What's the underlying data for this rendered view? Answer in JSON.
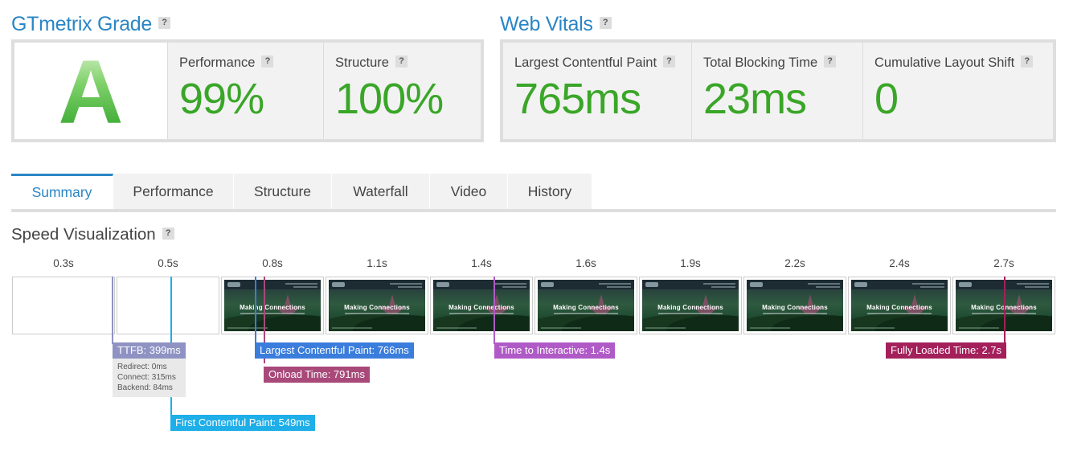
{
  "gtmetrix_grade": {
    "title": "GTmetrix Grade",
    "grade": "A",
    "performance": {
      "label": "Performance",
      "value": "99%"
    },
    "structure": {
      "label": "Structure",
      "value": "100%"
    }
  },
  "web_vitals": {
    "title": "Web Vitals",
    "lcp": {
      "label": "Largest Contentful Paint",
      "value": "765ms"
    },
    "tbt": {
      "label": "Total Blocking Time",
      "value": "23ms"
    },
    "cls": {
      "label": "Cumulative Layout Shift",
      "value": "0"
    }
  },
  "help_icon": "?",
  "tabs": [
    "Summary",
    "Performance",
    "Structure",
    "Waterfall",
    "Video",
    "History"
  ],
  "active_tab": "Summary",
  "speed_visualization": {
    "title": "Speed Visualization",
    "frame_times": [
      "0.3s",
      "0.5s",
      "0.8s",
      "1.1s",
      "1.4s",
      "1.6s",
      "1.9s",
      "2.2s",
      "2.4s",
      "2.7s"
    ],
    "frame_hero_text": "Making Connections",
    "markers": {
      "ttfb": "TTFB: 399ms",
      "ttfb_redirect": "Redirect: 0ms",
      "ttfb_connect": "Connect: 315ms",
      "ttfb_backend": "Backend: 84ms",
      "fcp": "First Contentful Paint: 549ms",
      "lcp": "Largest Contentful Paint: 766ms",
      "onload": "Onload Time: 791ms",
      "tti": "Time to Interactive: 1.4s",
      "fully_loaded": "Fully Loaded Time: 2.7s"
    },
    "marker_colors": {
      "ttfb": "#8f93c3",
      "fcp": "#1eaee8",
      "lcp": "#3a7ddc",
      "onload": "#a8497a",
      "tti": "#b05ac7",
      "fully_loaded": "#a3205b"
    }
  },
  "colors": {
    "accent_blue": "#2a86c5",
    "score_green": "#3aa628"
  }
}
